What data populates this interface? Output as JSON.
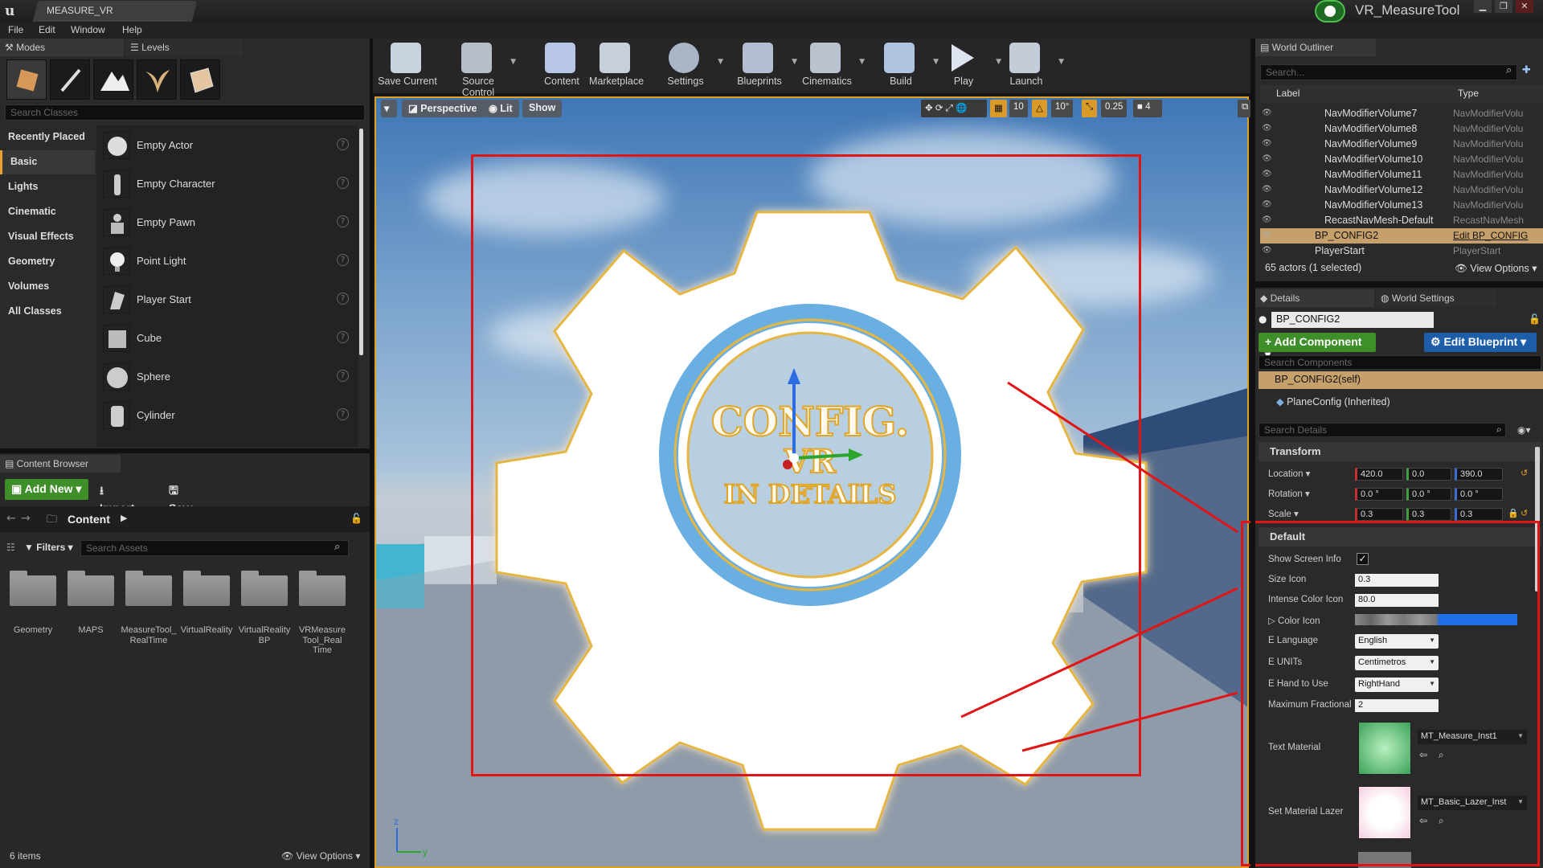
{
  "window": {
    "tab_title": "MEASURE_VR",
    "project_name": "VR_MeasureTool"
  },
  "menu": [
    "File",
    "Edit",
    "Window",
    "Help"
  ],
  "left_tabs": {
    "modes": "Modes",
    "levels": "Levels"
  },
  "modes": {
    "search_placeholder": "Search Classes",
    "categories": [
      "Recently Placed",
      "Basic",
      "Lights",
      "Cinematic",
      "Visual Effects",
      "Geometry",
      "Volumes",
      "All Classes"
    ],
    "items": [
      "Empty Actor",
      "Empty Character",
      "Empty Pawn",
      "Point Light",
      "Player Start",
      "Cube",
      "Sphere",
      "Cylinder"
    ]
  },
  "content_browser": {
    "tab": "Content Browser",
    "add_new": "Add New",
    "import": "Import",
    "save_all": "Save All",
    "path": "Content",
    "filters": "Filters",
    "search_placeholder": "Search Assets",
    "folders": [
      "Geometry",
      "MAPS",
      "MeasureTool_ RealTime",
      "VirtualReality",
      "VirtualReality BP",
      "VRMeasure Tool_Real Time"
    ],
    "status": "6 items",
    "view_options": "View Options"
  },
  "toolbar": [
    "Save Current",
    "Source Control",
    "Content",
    "Marketplace",
    "Settings",
    "Blueprints",
    "Cinematics",
    "Build",
    "Play",
    "Launch"
  ],
  "viewport": {
    "perspective": "Perspective",
    "lit": "Lit",
    "show": "Show",
    "grid_snap": "10",
    "rot_snap": "10°",
    "scale_snap": "0.25",
    "cam_speed": "4",
    "logo_line1": "CONFIG.",
    "logo_line2": "VR",
    "logo_line3": "IN DETAILS"
  },
  "outliner": {
    "tab": "World Outliner",
    "search_placeholder": "Search...",
    "col_label": "Label",
    "col_type": "Type",
    "rows": [
      {
        "label": "NavModifierVolume7",
        "type": "NavModifierVolu"
      },
      {
        "label": "NavModifierVolume8",
        "type": "NavModifierVolu"
      },
      {
        "label": "NavModifierVolume9",
        "type": "NavModifierVolu"
      },
      {
        "label": "NavModifierVolume10",
        "type": "NavModifierVolu"
      },
      {
        "label": "NavModifierVolume11",
        "type": "NavModifierVolu"
      },
      {
        "label": "NavModifierVolume12",
        "type": "NavModifierVolu"
      },
      {
        "label": "NavModifierVolume13",
        "type": "NavModifierVolu"
      },
      {
        "label": "RecastNavMesh-Default",
        "type": "RecastNavMesh"
      },
      {
        "label": "BP_CONFIG2",
        "type": "Edit BP_CONFIG"
      },
      {
        "label": "PlayerStart",
        "type": "PlayerStart"
      }
    ],
    "status": "65 actors (1 selected)",
    "view_options": "View Options"
  },
  "details": {
    "tab": "Details",
    "tab2": "World Settings",
    "actor_name": "BP_CONFIG2",
    "add_component": "+ Add Component",
    "edit_blueprint": "Edit Blueprint",
    "search_components": "Search Components",
    "self_component": "BP_CONFIG2(self)",
    "plane_component": "PlaneConfig (Inherited)",
    "search_details": "Search Details",
    "transform": {
      "header": "Transform",
      "location_label": "Location",
      "location": [
        "420.0",
        "0.0",
        "390.0"
      ],
      "rotation_label": "Rotation",
      "rotation": [
        "0.0 °",
        "0.0 °",
        "0.0 °"
      ],
      "scale_label": "Scale",
      "scale": [
        "0.3",
        "0.3",
        "0.3"
      ]
    },
    "default": {
      "header": "Default",
      "show_screen_info": "Show Screen Info",
      "size_icon": "Size Icon",
      "size_icon_value": "0.3",
      "intense_color_icon": "Intense Color Icon",
      "intense_color_value": "80.0",
      "color_icon": "Color Icon",
      "e_language": "E Language",
      "e_language_value": "English",
      "e_units": "E UNITs",
      "e_units_value": "Centimetros",
      "e_hand": "E Hand to Use",
      "e_hand_value": "RightHand",
      "max_fractional": "Maximum Fractional",
      "max_fractional_value": "2",
      "text_material": "Text Material",
      "text_material_value": "MT_Measure_Inst1",
      "set_material_lazer": "Set Material Lazer",
      "lazer_material_value": "MT_Basic_Lazer_Inst"
    }
  },
  "colors": {
    "accent_green": "#3e8e2a",
    "accent_blue": "#1e5ea8",
    "highlight_red": "#e01515",
    "selection": "#c6a06a"
  }
}
